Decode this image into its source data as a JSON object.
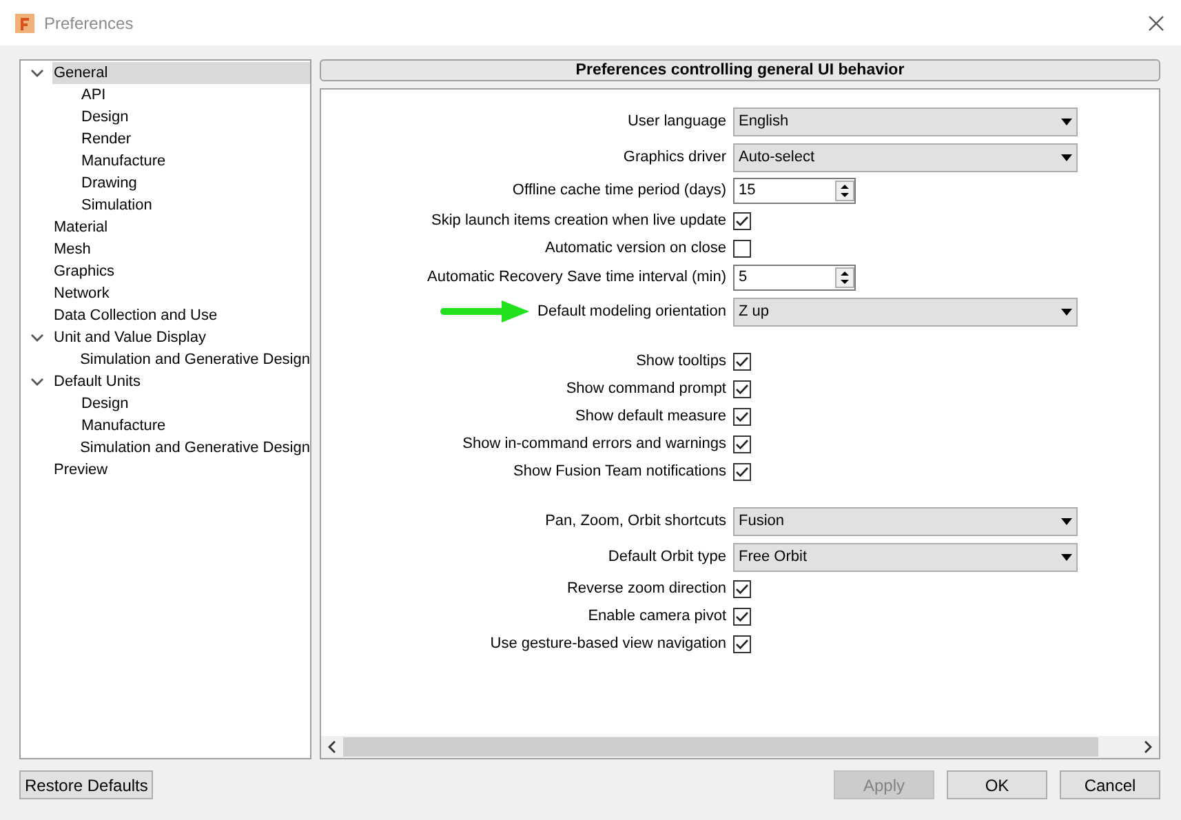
{
  "window": {
    "title": "Preferences"
  },
  "tree": [
    {
      "label": "General",
      "selected": true,
      "expanded": true,
      "children": [
        {
          "label": "API",
          "selected": false
        },
        {
          "label": "Design",
          "selected": false
        },
        {
          "label": "Render",
          "selected": false
        },
        {
          "label": "Manufacture",
          "selected": false
        },
        {
          "label": "Drawing",
          "selected": false
        },
        {
          "label": "Simulation",
          "selected": false
        }
      ]
    },
    {
      "label": "Material",
      "selected": false
    },
    {
      "label": "Mesh",
      "selected": false
    },
    {
      "label": "Graphics",
      "selected": false
    },
    {
      "label": "Network",
      "selected": false
    },
    {
      "label": "Data Collection and Use",
      "selected": false
    },
    {
      "label": "Unit and Value Display",
      "selected": false,
      "expanded": true,
      "children": [
        {
          "label": "Simulation and Generative Design",
          "selected": false
        }
      ]
    },
    {
      "label": "Default Units",
      "selected": false,
      "expanded": true,
      "children": [
        {
          "label": "Design",
          "selected": false
        },
        {
          "label": "Manufacture",
          "selected": false
        },
        {
          "label": "Simulation and Generative Design",
          "selected": false
        }
      ]
    },
    {
      "label": "Preview",
      "selected": false
    }
  ],
  "panel": {
    "title": "Preferences controlling general UI behavior",
    "groups": [
      [
        {
          "kind": "dropdown",
          "label": "User language",
          "value": "English",
          "arrow": false
        },
        {
          "kind": "dropdown",
          "label": "Graphics driver",
          "value": "Auto-select",
          "arrow": false
        },
        {
          "kind": "spinner",
          "label": "Offline cache time period (days)",
          "value": "15",
          "arrow": false
        },
        {
          "kind": "checkbox",
          "label": "Skip launch items creation when live update",
          "checked": true,
          "arrow": false
        },
        {
          "kind": "checkbox",
          "label": "Automatic version on close",
          "checked": false,
          "arrow": false
        },
        {
          "kind": "spinner",
          "label": "Automatic Recovery Save time interval (min)",
          "value": "5",
          "arrow": false
        },
        {
          "kind": "dropdown",
          "label": "Default modeling orientation",
          "value": "Z up",
          "arrow": true
        }
      ],
      [
        {
          "kind": "checkbox",
          "label": "Show tooltips",
          "checked": true,
          "arrow": false
        },
        {
          "kind": "checkbox",
          "label": "Show command prompt",
          "checked": true,
          "arrow": false
        },
        {
          "kind": "checkbox",
          "label": "Show default measure",
          "checked": true,
          "arrow": false
        },
        {
          "kind": "checkbox",
          "label": "Show in-command errors and warnings",
          "checked": true,
          "arrow": false
        },
        {
          "kind": "checkbox",
          "label": "Show Fusion Team notifications",
          "checked": true,
          "arrow": false
        }
      ],
      [
        {
          "kind": "dropdown",
          "label": "Pan, Zoom, Orbit shortcuts",
          "value": "Fusion",
          "arrow": false
        },
        {
          "kind": "dropdown",
          "label": "Default Orbit type",
          "value": "Free Orbit",
          "arrow": false
        },
        {
          "kind": "checkbox",
          "label": "Reverse zoom direction",
          "checked": true,
          "arrow": false
        },
        {
          "kind": "checkbox",
          "label": "Enable camera pivot",
          "checked": true,
          "arrow": false
        },
        {
          "kind": "checkbox",
          "label": "Use gesture-based view navigation",
          "checked": true,
          "arrow": false
        }
      ]
    ]
  },
  "restore_button": "Restore Defaults",
  "buttons": [
    {
      "label": "Apply",
      "disabled": true
    },
    {
      "label": "OK",
      "disabled": false
    },
    {
      "label": "Cancel",
      "disabled": false
    }
  ]
}
